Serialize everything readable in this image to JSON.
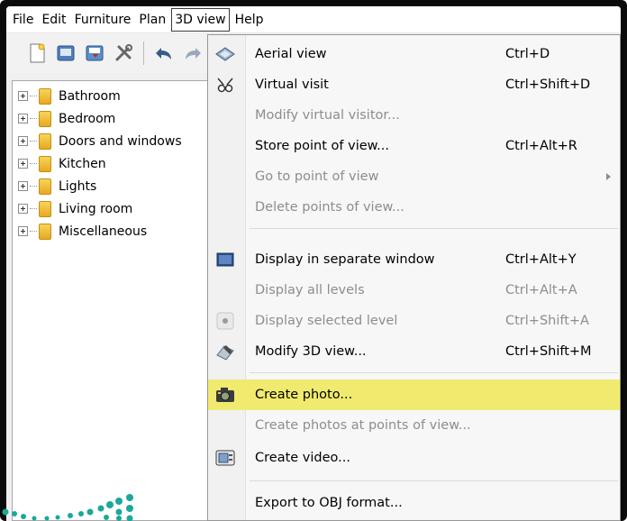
{
  "menubar": {
    "items": [
      "File",
      "Edit",
      "Furniture",
      "Plan",
      "3D view",
      "Help"
    ]
  },
  "toolbar": {
    "icons": [
      "new-document-icon",
      "open-folder-icon",
      "save-icon",
      "preferences-icon",
      "undo-icon",
      "redo-icon"
    ]
  },
  "catalog": {
    "categories": [
      "Bathroom",
      "Bedroom",
      "Doors and windows",
      "Kitchen",
      "Lights",
      "Living room",
      "Miscellaneous"
    ]
  },
  "menu_3d_view": {
    "items": [
      {
        "label": "Aerial view",
        "shortcut": "Ctrl+D",
        "enabled": true,
        "icon": "aerial-view-icon"
      },
      {
        "label": "Virtual visit",
        "shortcut": "Ctrl+Shift+D",
        "enabled": true,
        "icon": "virtual-visit-icon"
      },
      {
        "label": "Modify virtual visitor...",
        "shortcut": "",
        "enabled": false
      },
      {
        "label": "Store point of view...",
        "shortcut": "Ctrl+Alt+R",
        "enabled": true
      },
      {
        "label": "Go to point of view",
        "shortcut": "",
        "enabled": false,
        "submenu": true
      },
      {
        "label": "Delete points of view...",
        "shortcut": "",
        "enabled": false
      },
      {
        "label": "Display in separate window",
        "shortcut": "Ctrl+Alt+Y",
        "enabled": true,
        "icon": "separate-window-icon"
      },
      {
        "label": "Display all levels",
        "shortcut": "Ctrl+Alt+A",
        "enabled": false
      },
      {
        "label": "Display selected level",
        "shortcut": "Ctrl+Shift+A",
        "enabled": false,
        "icon": "radio-dot-icon"
      },
      {
        "label": "Modify 3D view...",
        "shortcut": "Ctrl+Shift+M",
        "enabled": true,
        "icon": "modify-3d-view-icon"
      },
      {
        "label": "Create photo...",
        "shortcut": "",
        "enabled": true,
        "highlighted": true,
        "icon": "camera-icon"
      },
      {
        "label": "Create photos at points of view...",
        "shortcut": "",
        "enabled": false
      },
      {
        "label": "Create video...",
        "shortcut": "",
        "enabled": true,
        "icon": "video-icon"
      },
      {
        "label": "Export to OBJ format...",
        "shortcut": "",
        "enabled": true
      }
    ]
  },
  "colors": {
    "highlight": "#f0eb6e",
    "disabled_text": "#8d8d8d",
    "frame": "#0b0b0b",
    "deco_dots": "#1aa89a"
  }
}
